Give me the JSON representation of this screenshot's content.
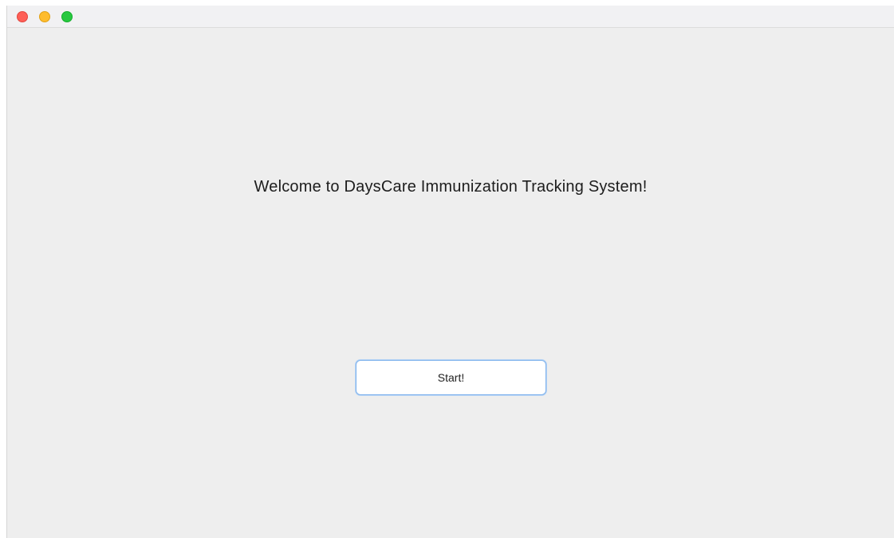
{
  "window": {
    "controls": {
      "close": "close-icon",
      "minimize": "minimize-icon",
      "maximize": "maximize-icon",
      "colors": {
        "close": "#fe5f57",
        "minimize": "#febc2e",
        "maximize": "#28c840"
      }
    }
  },
  "main": {
    "welcome_text": "Welcome to DaysCare Immunization Tracking System!",
    "start_button_label": "Start!",
    "accent_color": "#7fb2ec"
  }
}
